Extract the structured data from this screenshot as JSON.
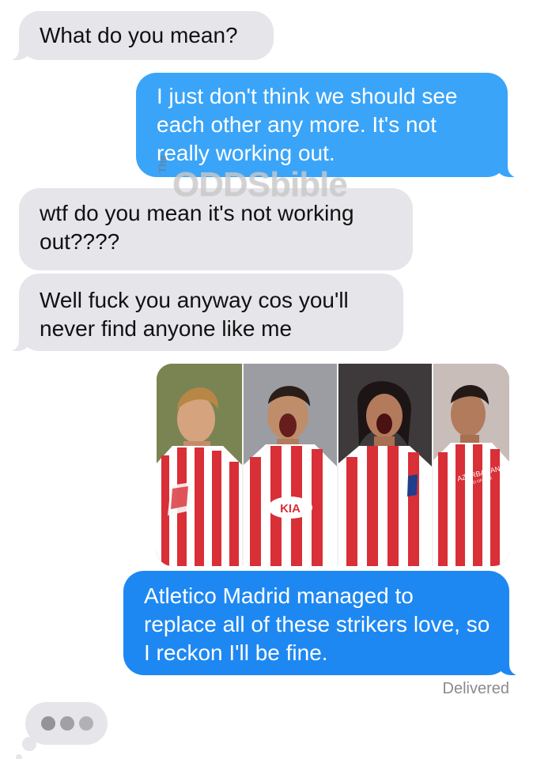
{
  "conversation": {
    "messages": [
      {
        "direction": "incoming",
        "text": "What do you mean?"
      },
      {
        "direction": "outgoing",
        "text": "I just don't think we should see each other any more. It's not really working out."
      },
      {
        "direction": "incoming",
        "text": "wtf do you mean it's not working out????"
      },
      {
        "direction": "incoming",
        "text": "Well fuck you anyway cos you'll never find anyone like me"
      },
      {
        "direction": "outgoing",
        "text": "Atletico Madrid managed to replace all of these strikers love, so I reckon I'll be fine."
      }
    ],
    "attachment": {
      "players": [
        {
          "icon": "footballer-photo-icon"
        },
        {
          "icon": "footballer-photo-icon"
        },
        {
          "icon": "footballer-photo-icon"
        },
        {
          "icon": "footballer-photo-icon"
        }
      ],
      "shirt_text": {
        "sponsor": "KIA",
        "country_sponsor": "AZERBAIJAN",
        "subtext": "LAND OF FIRE"
      }
    },
    "status": "Delivered",
    "typing_indicator": {
      "dots": 3
    }
  },
  "watermark": {
    "prefix": "The",
    "brand": "ODDSbible"
  },
  "colors": {
    "incoming_bubble": "#e5e5ea",
    "outgoing_bubble": "#1e88f2",
    "outgoing_bubble_light": "#3aa4f8",
    "status_text": "#8a8a8f",
    "background": "#ffffff",
    "kit_red": "#d92f37",
    "kit_white": "#ffffff",
    "kit_blue": "#1f3d8a"
  }
}
